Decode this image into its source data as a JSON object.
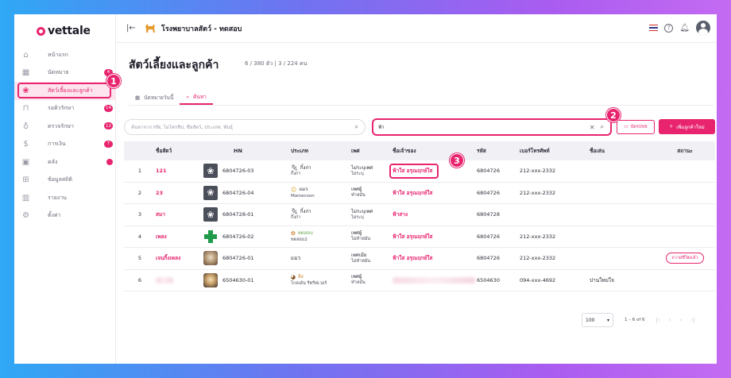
{
  "brand": {
    "name": "vettale",
    "color": "#e8246e"
  },
  "sidebar": {
    "items": [
      {
        "label": "หน้าแรก",
        "icon": "home-icon"
      },
      {
        "label": "นัดหมาย",
        "icon": "calendar-icon",
        "badge": "4"
      },
      {
        "label": "สัตว์เลี้ยงและลูกค้า",
        "icon": "paw-icon",
        "active": true
      },
      {
        "label": "รอคิวรักษา",
        "icon": "couch-icon",
        "badge": "14"
      },
      {
        "label": "ตรวจรักษา",
        "icon": "stethoscope-icon",
        "badge": "12"
      },
      {
        "label": "การเงิน",
        "icon": "money-icon",
        "badge": "7"
      },
      {
        "label": "คลัง",
        "icon": "box-icon",
        "dot": true
      },
      {
        "label": "ข้อมูลสถิติ",
        "icon": "grid-icon"
      },
      {
        "label": "รายงาน",
        "icon": "chart-icon"
      },
      {
        "label": "ตั้งค่า",
        "icon": "gear-icon"
      }
    ]
  },
  "topbar": {
    "clinic_name": "โรงพยาบาลสัตว์ - ทดสอบ"
  },
  "page": {
    "title": "สัตว์เลี้ยงและลูกค้า",
    "counts": "6 / 380 ตัว | 3 / 224 คน"
  },
  "tabs": [
    {
      "label": "นัดหมายวันนี้",
      "icon": "calendar-icon"
    },
    {
      "label": "ค้นหา",
      "icon": "search-icon",
      "active": true
    }
  ],
  "search": {
    "placeholder": "ค้นหาจาก HN, ไมโครชิป, ชื่อสัตว์, ประเภท, พันธุ์",
    "owner_value": "ฟ้า",
    "scan_label": "บัตรปชช",
    "add_label": "เพิ่มลูกค้าใหม่"
  },
  "callouts": [
    "1",
    "2",
    "3"
  ],
  "table": {
    "headers": [
      "",
      "ชื่อสัตว์",
      "HN",
      "ประเภท",
      "เพศ",
      "ชื่อเจ้าของ",
      "รหัส",
      "เบอร์โทรศัพท์",
      "ชื่อเล่น",
      "สถานะ"
    ],
    "rows": [
      {
        "no": "1",
        "name": "121",
        "hn": "6804726-03",
        "img": "paw",
        "species": "กิ้งก่า",
        "breed": "กิ้งก่า",
        "sp_icon": "lizard-icon",
        "sex1": "ไม่ระบุเพศ",
        "sex2": "ไม่ระบุ",
        "owner": "ฟ้าใส อรุณฤกษ์ใส",
        "code": "6804726",
        "phone": "212-xxx-2332",
        "nick": "",
        "status": ""
      },
      {
        "no": "2",
        "name": "23",
        "hn": "6804726-04",
        "img": "paw",
        "species": "แมว",
        "breed": "Mainecoon",
        "sp_icon": "cat-icon",
        "sex1": "เพศผู้",
        "sex2": "ทำหมัน",
        "owner": "ฟ้าใส อรุณฤกษ์ใส",
        "code": "6804726",
        "phone": "212-xxx-2332",
        "nick": "",
        "status": ""
      },
      {
        "no": "3",
        "name": "สมา",
        "hn": "6804728-01",
        "img": "paw",
        "species": "กิ้งก่า",
        "breed": "กิ้งก่า",
        "sp_icon": "lizard-icon",
        "sex1": "ไม่ระบุเพศ",
        "sex2": "ไม่ระบุ",
        "owner": "ฟ้าสาง",
        "code": "6804728",
        "phone": "",
        "nick": "",
        "status": ""
      },
      {
        "no": "4",
        "name": "เพลง",
        "hn": "6804726-02",
        "img": "cross",
        "species": "ทดสอบ",
        "breed": "ทดสอบ2",
        "sp_icon": "test-icon",
        "sex1": "เพศผู้",
        "sex2": "ไม่ทำหมัน",
        "owner": "ฟ้าใส อรุณฤกษ์ใส",
        "code": "6804726",
        "phone": "212-xxx-2332",
        "nick": "",
        "status": ""
      },
      {
        "no": "5",
        "name": "เจนกิ้งเพลง",
        "hn": "6804726-01",
        "img": "photo",
        "species": "แมว",
        "breed": "",
        "sp_icon": "",
        "sex1": "เพศเมีย",
        "sex2": "ไม่ทำหมัน",
        "owner": "ฟ้าใส อรุณฤกษ์ใส",
        "code": "6804726",
        "phone": "212-xxx-2332",
        "nick": "",
        "status": "ถวายชีวิตแล้ว"
      },
      {
        "no": "6",
        "name": "",
        "hn": "6504630-01",
        "img": "photo2",
        "species": "ลิง",
        "breed": "โกลเด้น รีทรีฟเวอร์",
        "sp_icon": "monkey-icon",
        "sex1": "เพศผู้",
        "sex2": "ทำหมัน",
        "owner": "",
        "code": "6504630",
        "phone": "094-xxx-4692",
        "nick": "ปานใหม่ใจ",
        "status": ""
      }
    ]
  },
  "pager": {
    "page_size": "100",
    "info": "1 – 6 of 6"
  }
}
